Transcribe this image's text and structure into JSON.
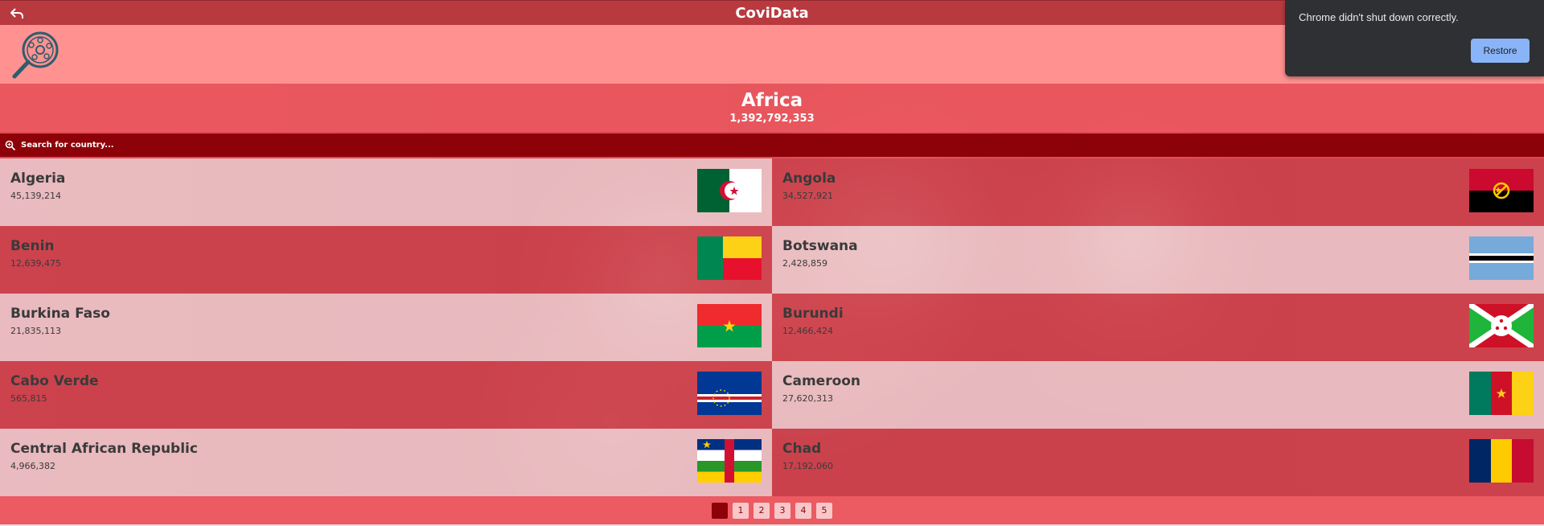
{
  "header": {
    "title": "CoviData"
  },
  "region": {
    "name": "Africa",
    "population": "1,392,792,353"
  },
  "search": {
    "placeholder": "Search for country..."
  },
  "countries": [
    {
      "name": "Algeria",
      "population": "45,139,214",
      "flag": "algeria-flag"
    },
    {
      "name": "Angola",
      "population": "34,527,921",
      "flag": "angola-flag"
    },
    {
      "name": "Benin",
      "population": "12,639,475",
      "flag": "benin-flag"
    },
    {
      "name": "Botswana",
      "population": "2,428,859",
      "flag": "botswana-flag"
    },
    {
      "name": "Burkina Faso",
      "population": "21,835,113",
      "flag": "burkina-faso-flag"
    },
    {
      "name": "Burundi",
      "population": "12,466,424",
      "flag": "burundi-flag"
    },
    {
      "name": "Cabo Verde",
      "population": "565,815",
      "flag": "cabo-verde-flag"
    },
    {
      "name": "Cameroon",
      "population": "27,620,313",
      "flag": "cameroon-flag"
    },
    {
      "name": "Central African Republic",
      "population": "4,966,382",
      "flag": "central-african-republic-flag"
    },
    {
      "name": "Chad",
      "population": "17,192,060",
      "flag": "chad-flag"
    }
  ],
  "pagination": {
    "pages": [
      "1",
      "2",
      "3",
      "4",
      "5"
    ],
    "current_label": "1"
  },
  "notification": {
    "message": "Chrome didn't shut down correctly.",
    "button": "Restore"
  },
  "colors": {
    "header": "#b83a3f",
    "search_bar": "#8d0208",
    "logo_band": "#ff9290",
    "accent_button": "#8ab4f8"
  }
}
